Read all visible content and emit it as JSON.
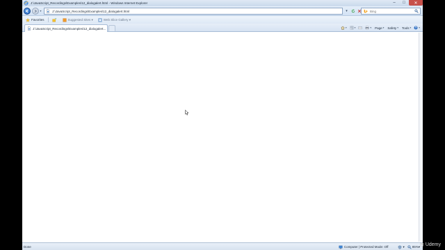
{
  "window": {
    "title": "J:\\JavaScript_Recordings\\Examples\\12_dialogalert.html - Windows Internet Explorer",
    "minimize": "–",
    "maximize": "□",
    "close": "✕"
  },
  "navigation": {
    "address_value": "J:\\JavaScript_Recordings\\Examples\\12_dialogalert.html",
    "search_placeholder": "Bing",
    "refresh_icon": "refresh-icon",
    "stop_icon": "stop-icon"
  },
  "favorites_bar": {
    "favorites_label": "Favorites",
    "suggested_sites_label": "Suggested Sites ▾",
    "web_slice_gallery_label": "Web Slice Gallery ▾"
  },
  "tab": {
    "label": "J:\\JavaScript_Recordings\\Examples\\12_dialogalert..."
  },
  "command_bar": {
    "page_label": "Page",
    "safety_label": "Safety",
    "tools_label": "Tools"
  },
  "status_bar": {
    "status_text": "Done",
    "zone_text": "Computer | Protected Mode: Off",
    "zoom_text": "85%"
  },
  "watermark": {
    "text": "Udemy"
  },
  "colors": {
    "chrome_light": "#dfe9f5",
    "chrome_dark": "#c9d9ec",
    "close_button": "#c7504a",
    "page_background": "#ffffff"
  }
}
